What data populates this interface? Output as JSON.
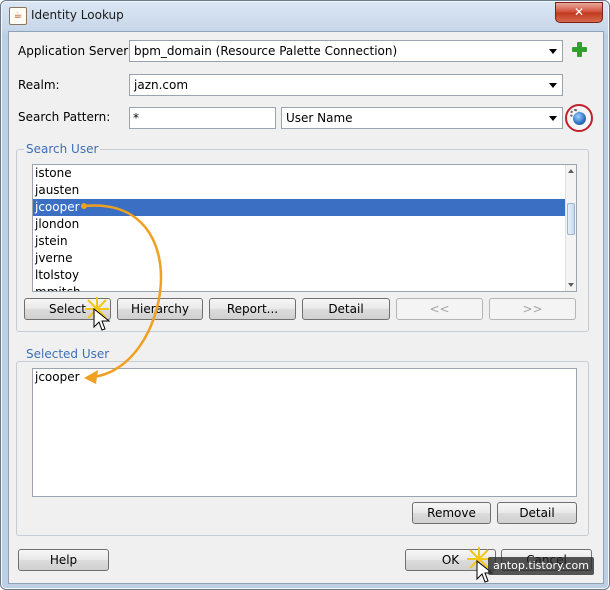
{
  "window": {
    "title": "Identity Lookup",
    "close_label": "✕"
  },
  "form": {
    "app_server_label": "Application Server:",
    "app_server_value": "bpm_domain (Resource Palette Connection)",
    "realm_label": "Realm:",
    "realm_value": "jazn.com",
    "search_pattern_label": "Search Pattern:",
    "search_pattern_value": "*",
    "search_field_value": "User Name"
  },
  "search_user": {
    "legend": "Search User",
    "items": [
      "istone",
      "jausten",
      "jcooper",
      "jlondon",
      "jstein",
      "jverne",
      "ltolstoy",
      "mmitch"
    ],
    "selected": "jcooper",
    "buttons": {
      "select": "Select",
      "hierarchy": "Hierarchy",
      "report": "Report...",
      "detail": "Detail",
      "prev": "<<",
      "next": ">>"
    }
  },
  "selected_user": {
    "legend": "Selected User",
    "items": [
      "jcooper"
    ],
    "buttons": {
      "remove": "Remove",
      "detail": "Detail"
    }
  },
  "footer": {
    "help": "Help",
    "ok": "OK",
    "cancel": "Cancel"
  },
  "watermark": "antop.tistory.com",
  "colors": {
    "selection": "#3a6fc4",
    "legend": "#3e6fb5",
    "annotation_arrow": "#f0a020",
    "highlight_circle": "#c0222c"
  }
}
